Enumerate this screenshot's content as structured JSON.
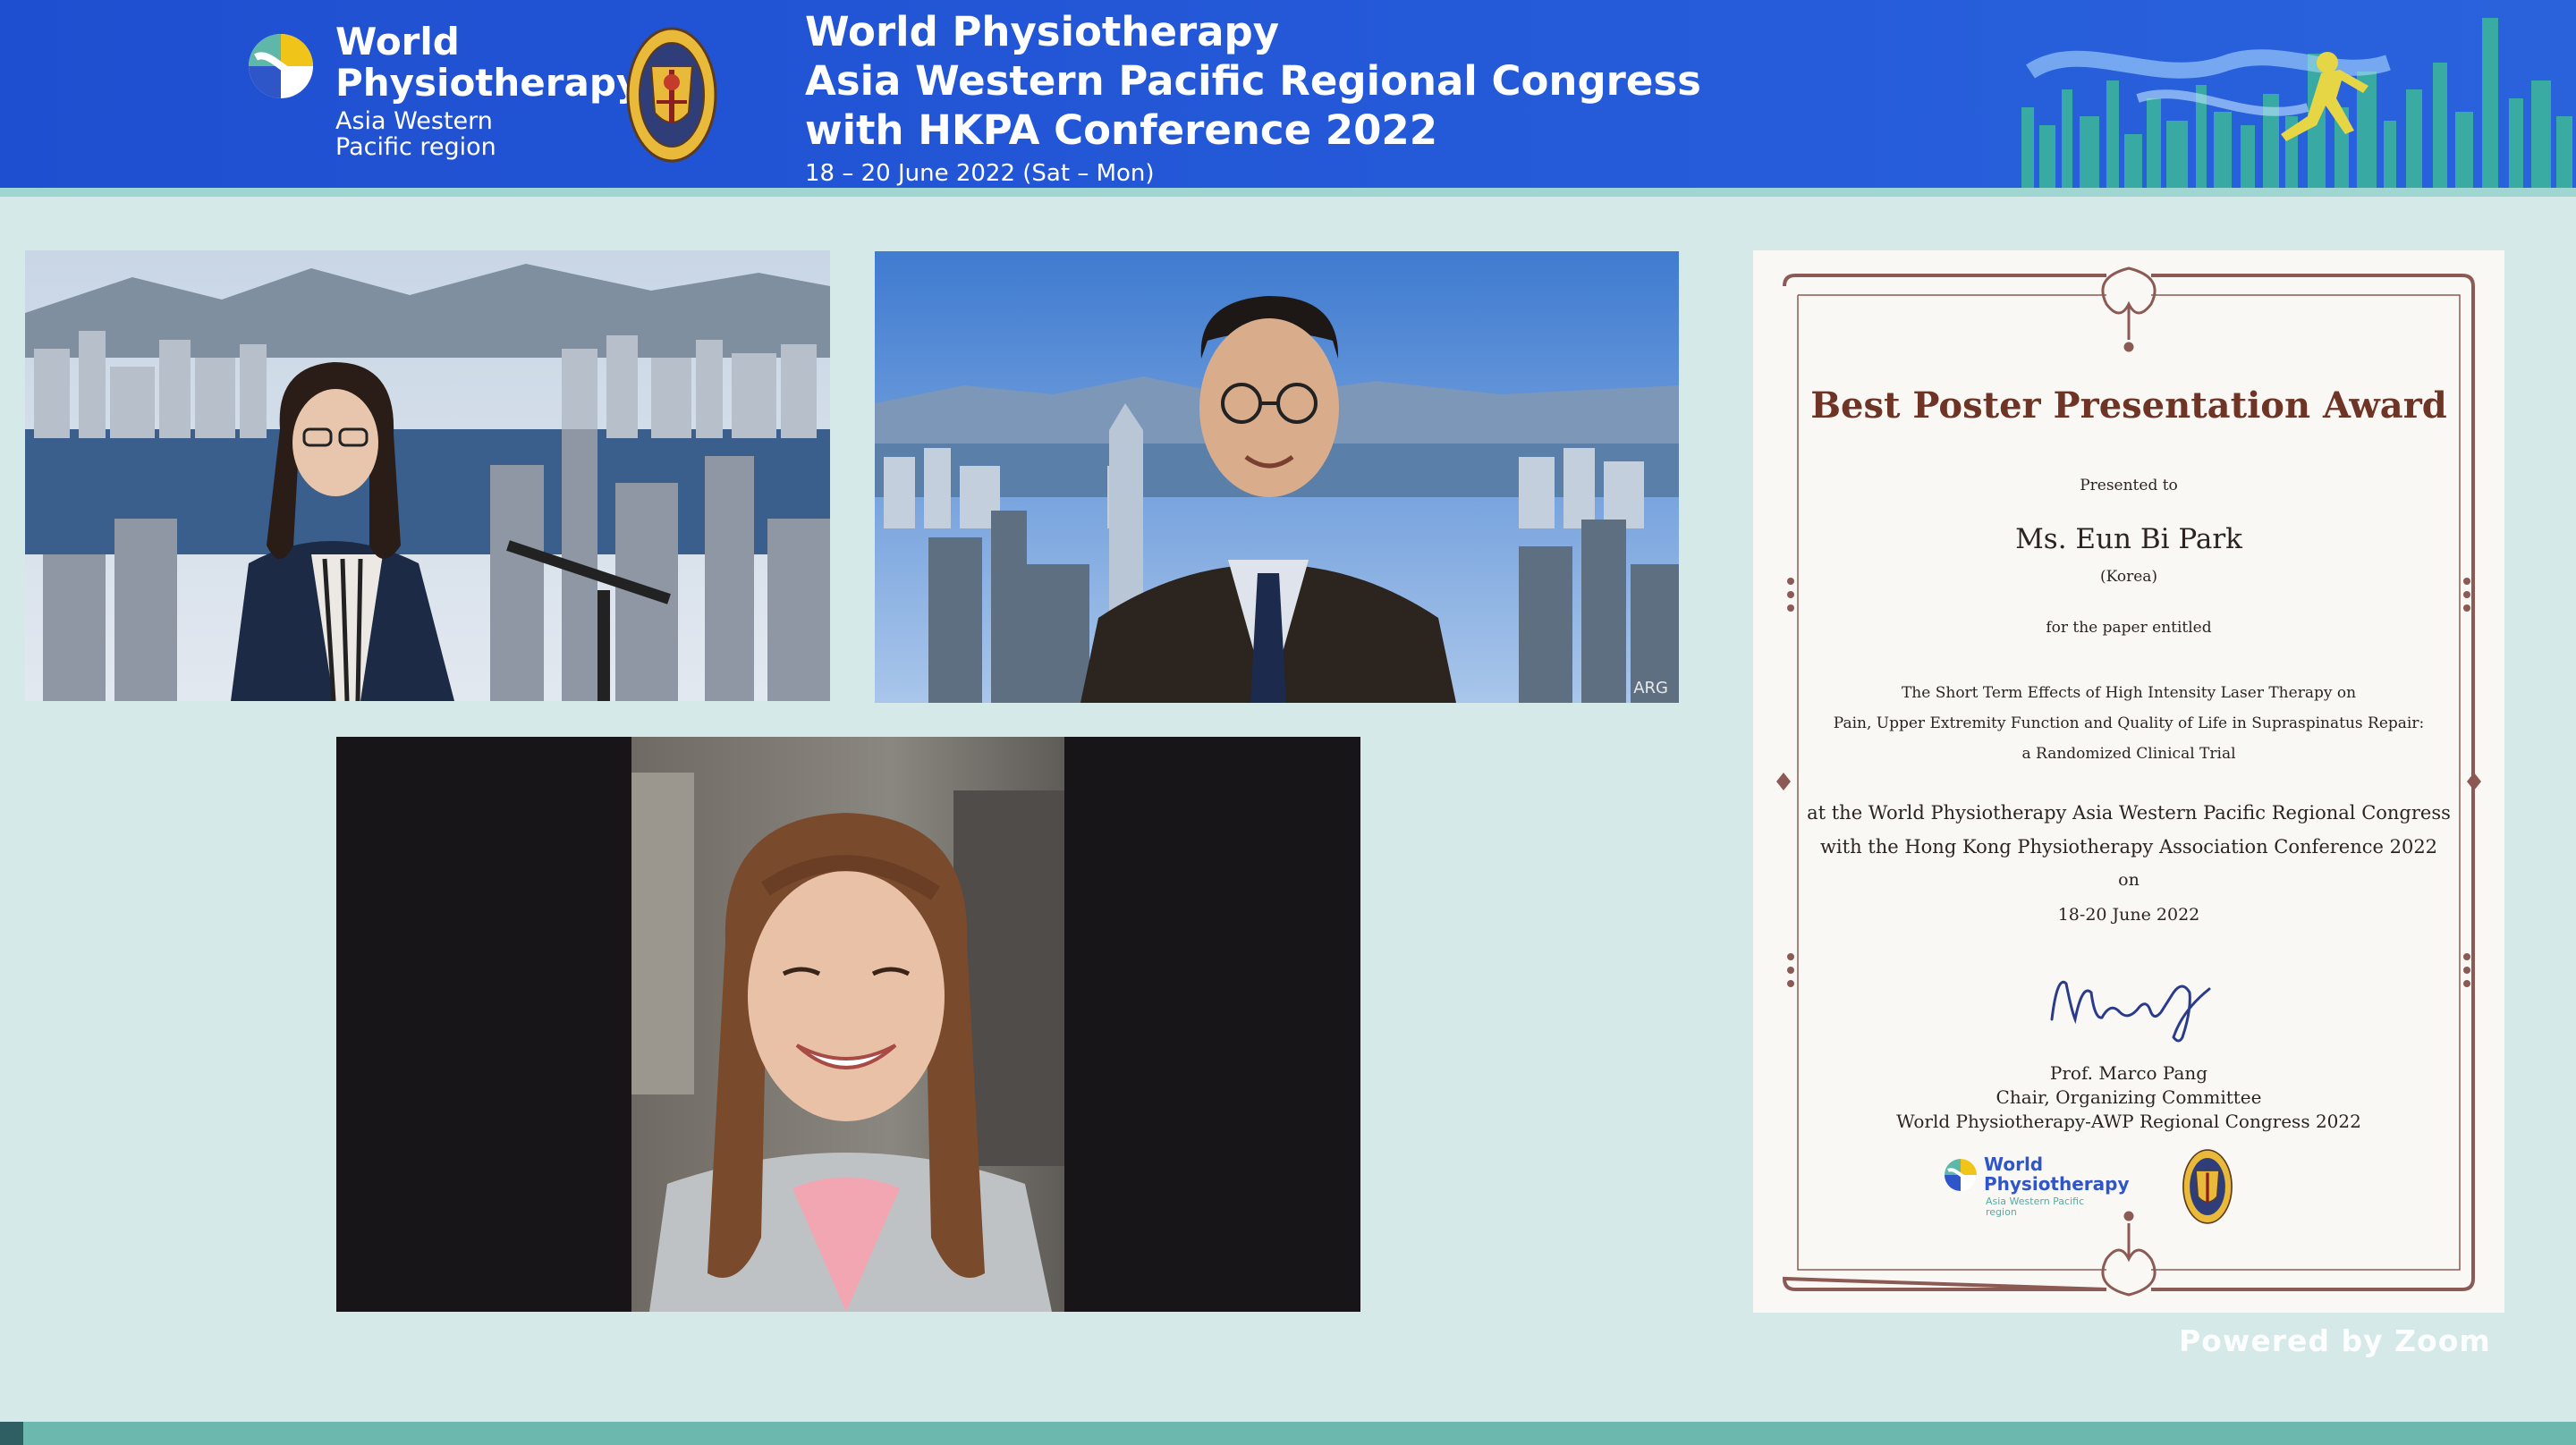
{
  "banner": {
    "org_line1": "World",
    "org_line2": "Physiotherapy",
    "region_line1": "Asia Western",
    "region_line2": "Pacific region",
    "congress_line1": "World Physiotherapy",
    "congress_line2": "Asia Western Pacific Regional Congress",
    "congress_line3": "with HKPA Conference 2022",
    "dates": "18 – 20 June 2022 (Sat – Mon)",
    "colors": {
      "primary": "#2459d8",
      "accent": "#9fd6d2"
    }
  },
  "participants": [
    {
      "tile": "participant-1",
      "background": "harbour-skyline",
      "label": ""
    },
    {
      "tile": "participant-2",
      "background": "harbour-skyline",
      "label": "ARG"
    },
    {
      "tile": "participant-3",
      "background": "home-room",
      "label": ""
    }
  ],
  "certificate": {
    "title": "Best Poster Presentation Award",
    "presented_to": "Presented to",
    "recipient": "Ms. Eun Bi Park",
    "country": "(Korea)",
    "for_paper": "for the paper entitled",
    "paper_line1": "The Short Term Effects of High Intensity Laser Therapy on",
    "paper_line2": "Pain, Upper Extremity Function and Quality of Life in Supraspinatus Repair:",
    "paper_line3": "a Randomized Clinical Trial",
    "event_line1": "at the World Physiotherapy Asia Western Pacific Regional Congress",
    "event_line2": "with the Hong Kong Physiotherapy Association Conference 2022",
    "on": "on",
    "date": "18-20 June 2022",
    "signer_name": "Prof. Marco Pang",
    "signer_role": "Chair, Organizing Committee",
    "signer_org": "World Physiotherapy-AWP Regional Congress 2022",
    "logo_line1": "World",
    "logo_line2": "Physiotherapy",
    "logo_line3": "Asia Western Pacific region",
    "colors": {
      "title": "#6e3526",
      "frame": "#8b5a55"
    }
  },
  "footer": {
    "powered_by": "Powered by Zoom"
  }
}
